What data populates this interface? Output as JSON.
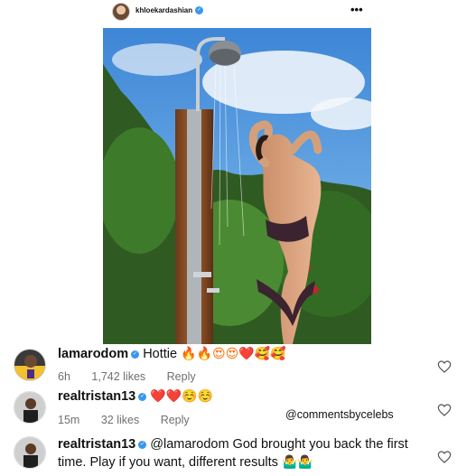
{
  "post": {
    "username": "khloekardashian",
    "more_label": "•••"
  },
  "comments": [
    {
      "username": "lamarodom",
      "text": "Hottie",
      "emojis": "🔥🔥😍😍❤️🥰🥰",
      "time": "6h",
      "likes": "1,742 likes",
      "reply": "Reply"
    },
    {
      "username": "realtristan13",
      "text": "",
      "emojis": "❤️❤️☺️☺️",
      "time": "15m",
      "likes": "32 likes",
      "reply": "Reply"
    },
    {
      "username": "realtristan13",
      "text": "@lamarodom God brought you back the first time. Play if you want, different results",
      "emojis": "🤷‍♂️🤷‍♂️"
    }
  ],
  "watermark": "@commentsbycelebs",
  "colors": {
    "verified": "#3897f0",
    "meta_text": "#6f6f6f"
  }
}
